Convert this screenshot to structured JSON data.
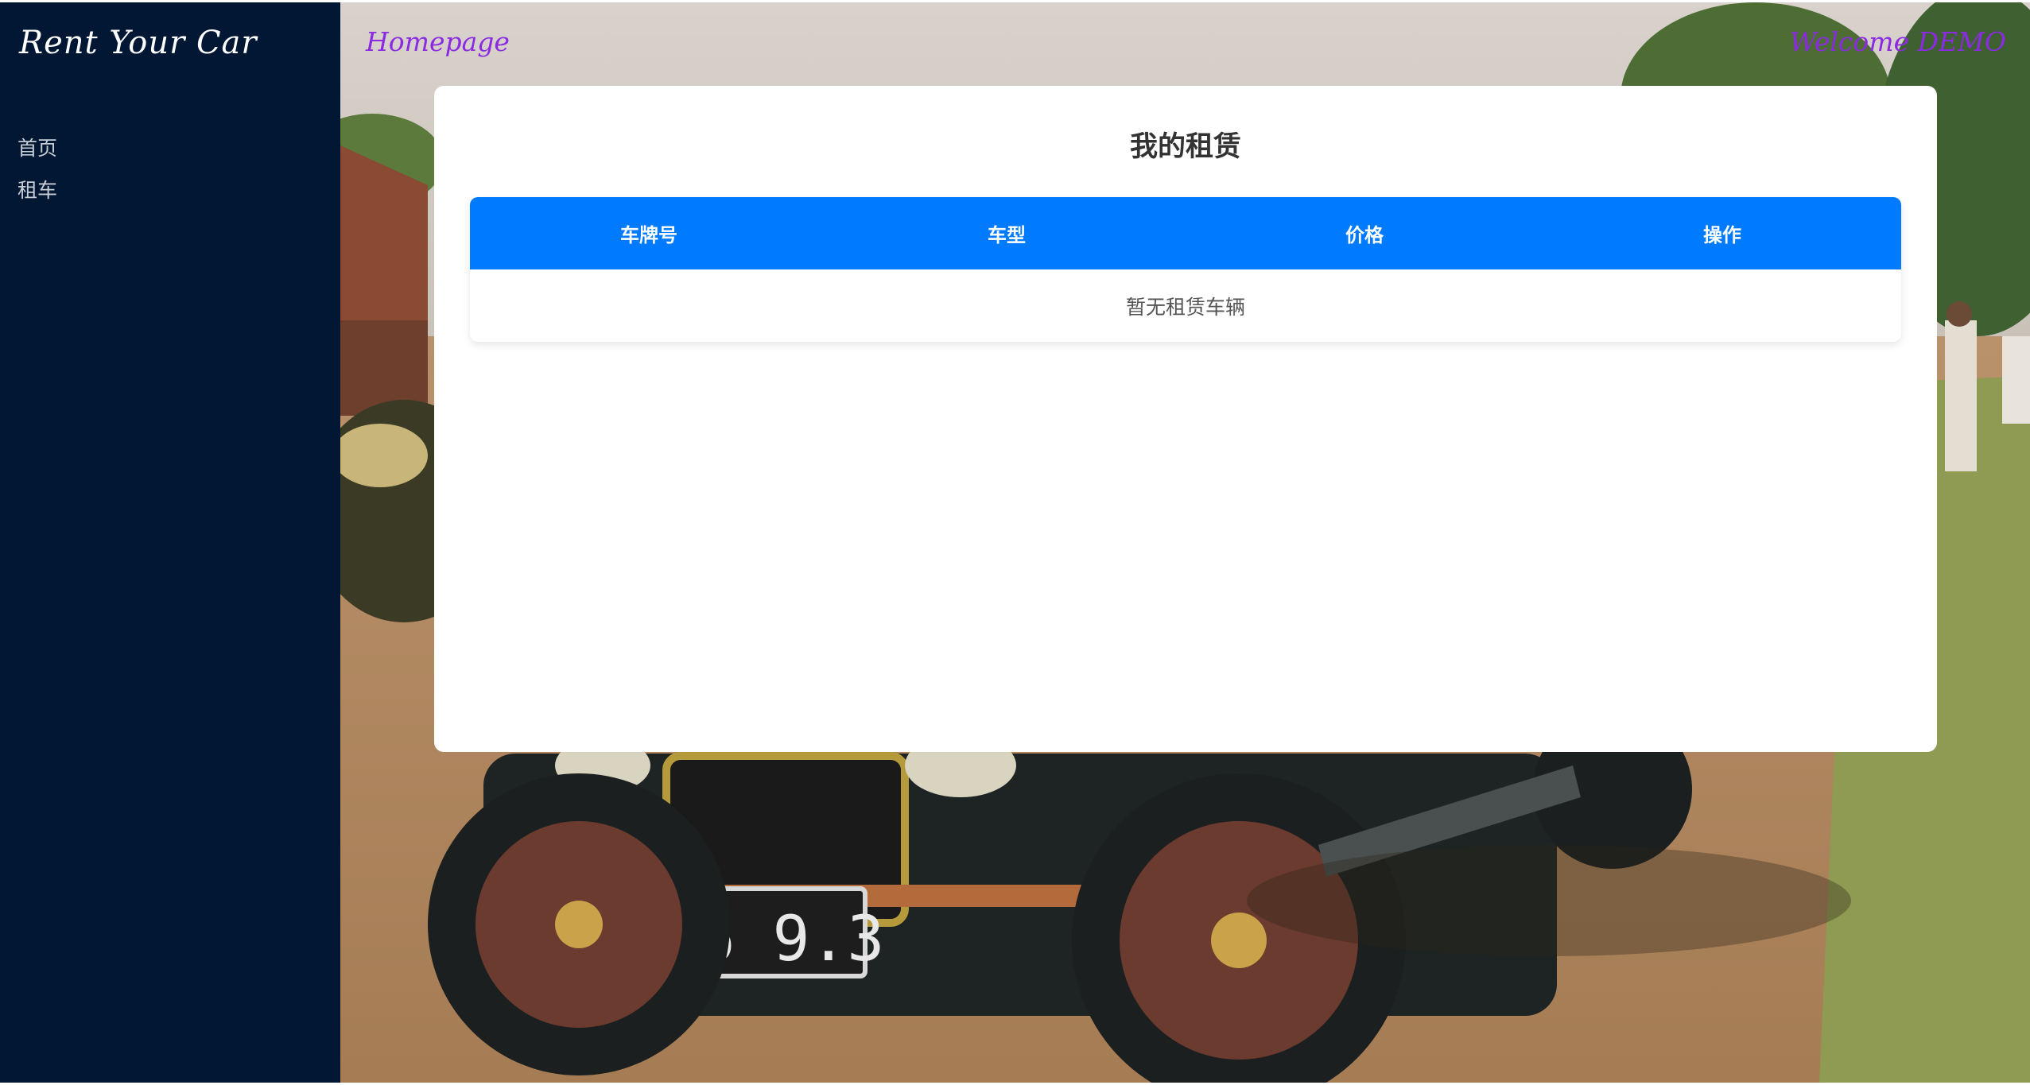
{
  "sidebar": {
    "brand": "Rent Your Car",
    "items": [
      {
        "label": "首页"
      },
      {
        "label": "租车"
      }
    ]
  },
  "header": {
    "homepage_link": "Homepage",
    "welcome": "Welcome DEMO"
  },
  "main": {
    "title": "我的租赁",
    "table": {
      "columns": [
        "车牌号",
        "车型",
        "价格",
        "操作"
      ],
      "empty_message": "暂无租赁车辆"
    }
  },
  "background": {
    "plate_text": "DI6 9.3"
  },
  "colors": {
    "sidebar_bg": "#011733",
    "accent": "#007bff",
    "link": "#8a2be2"
  }
}
